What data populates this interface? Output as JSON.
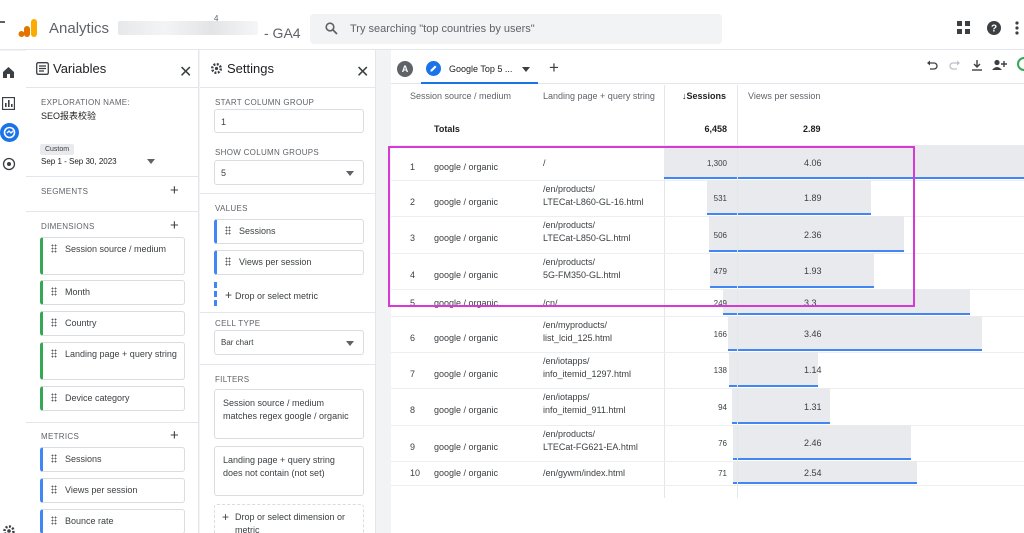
{
  "header": {
    "app_name": "Analytics",
    "account_suffix": "4",
    "property_name": "- GA4",
    "search_placeholder": "Try searching \"top countries by users\"",
    "icons": [
      "apps-grid-icon",
      "help-icon",
      "account-menu-icon"
    ]
  },
  "rail": {
    "icons": [
      "home-icon",
      "reports-icon",
      "explore-icon",
      "advertising-icon",
      "settings-icon"
    ]
  },
  "variables": {
    "title": "Variables",
    "exploration_name_label": "EXPLORATION NAME:",
    "exploration_name": "SEO报表校验",
    "date_range_label": "Custom",
    "date_range": "Sep 1 - Sep 30, 2023",
    "segments_label": "SEGMENTS",
    "dimensions_label": "DIMENSIONS",
    "dimensions": [
      "Session source / medium",
      "Month",
      "Country",
      "Landing page + query string",
      "Device category"
    ],
    "metrics_label": "METRICS",
    "metrics": [
      "Sessions",
      "Views per session",
      "Bounce rate"
    ]
  },
  "settings": {
    "title": "Settings",
    "start_column_group_label": "START COLUMN GROUP",
    "start_column_group": "1",
    "show_column_groups_label": "SHOW COLUMN GROUPS",
    "show_column_groups": "5",
    "values_label": "VALUES",
    "values": [
      "Sessions",
      "Views per session"
    ],
    "drop_metric": "Drop or select metric",
    "cell_type_label": "CELL TYPE",
    "cell_type": "Bar chart",
    "filters_label": "FILTERS",
    "filters": [
      "Session source / medium matches regex google / organic",
      "Landing page + query string does not contain (not set)"
    ],
    "drop_dimension": "Drop or select dimension or metric"
  },
  "report": {
    "tab_badge": "A",
    "tab_name": "Google Top 5 ...",
    "columns": {
      "source": "Session source / medium",
      "landing": "Landing page + query string",
      "sessions": "Sessions",
      "views": "Views per session"
    },
    "totals_label": "Totals",
    "totals_sessions": "6,458",
    "totals_views": "2.89",
    "rows": [
      {
        "n": "1",
        "source": "google / organic",
        "landing": "/",
        "sessions": "1,300",
        "views": "4.06",
        "s": 1300,
        "v": 4.06
      },
      {
        "n": "2",
        "source": "google / organic",
        "landing": "/en/products/\nLTECat-L860-GL-16.html",
        "sessions": "531",
        "views": "1.89",
        "s": 531,
        "v": 1.89
      },
      {
        "n": "3",
        "source": "google / organic",
        "landing": "/en/products/\nLTECat-L850-GL.html",
        "sessions": "506",
        "views": "2.36",
        "s": 506,
        "v": 2.36
      },
      {
        "n": "4",
        "source": "google / organic",
        "landing": "/en/products/\n5G-FM350-GL.html",
        "sessions": "479",
        "views": "1.93",
        "s": 479,
        "v": 1.93
      },
      {
        "n": "5",
        "source": "google / organic",
        "landing": "/cn/",
        "sessions": "249",
        "views": "3.3",
        "s": 249,
        "v": 3.3
      },
      {
        "n": "6",
        "source": "google / organic",
        "landing": "/en/myproducts/\nlist_lcid_125.html",
        "sessions": "166",
        "views": "3.46",
        "s": 166,
        "v": 3.46
      },
      {
        "n": "7",
        "source": "google / organic",
        "landing": "/en/iotapps/\ninfo_itemid_1297.html",
        "sessions": "138",
        "views": "1.14",
        "s": 138,
        "v": 1.14
      },
      {
        "n": "8",
        "source": "google / organic",
        "landing": "/en/iotapps/\ninfo_itemid_911.html",
        "sessions": "94",
        "views": "1.31",
        "s": 94,
        "v": 1.31
      },
      {
        "n": "9",
        "source": "google / organic",
        "landing": "/en/products/\nLTECat-FG621-EA.html",
        "sessions": "76",
        "views": "2.46",
        "s": 76,
        "v": 2.46
      },
      {
        "n": "10",
        "source": "google / organic",
        "landing": "/en/gywm/index.html",
        "sessions": "71",
        "views": "2.54",
        "s": 71,
        "v": 2.54
      }
    ],
    "highlight_color": "#d63ad6"
  }
}
